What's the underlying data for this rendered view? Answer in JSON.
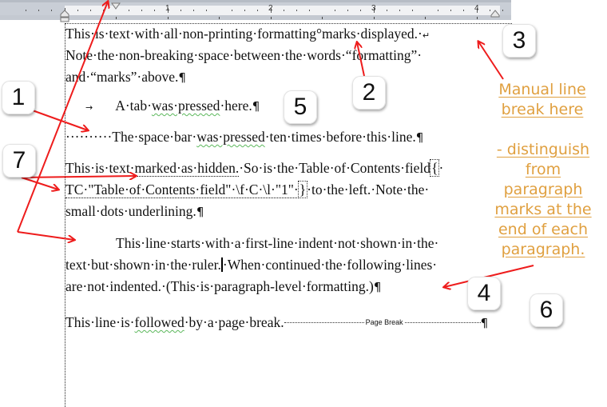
{
  "ruler": {
    "numbers": [
      "1",
      "2",
      "3",
      "4"
    ]
  },
  "document": {
    "p1": {
      "line1": "This·is·text·with·all·non-printing·formatting°marks·displayed.·",
      "line1_break": "↵",
      "line2": "Note·the·non-breaking·space·between·the·words·“formatting”·",
      "line3": "and·“marks”·above.",
      "pilcrow": "¶"
    },
    "p2": {
      "tab_mark": "→",
      "text_a": "A·tab·",
      "text_squig1": "was·pressed",
      "text_b": "·here.",
      "pilcrow": "¶"
    },
    "p3": {
      "dots": "··········",
      "text_a": "The·space·bar·",
      "text_squig": "was·pressed",
      "text_b": "·ten·times·before·this·line.",
      "pilcrow": "¶"
    },
    "p4": {
      "line1_a": "This·is·text·",
      "line1_hidden": "marked·as·hidden.",
      "line1_b": "·So·is·the·Table·of·Contents·field",
      "brace_open": "{",
      "line1_end": "·",
      "line2_hidden": "TC·\"Table·of·Contents·field\"·\\f·C·\\l·\"1\"·",
      "brace_close": "}",
      "line2_b": "·to·the·left.·Note·the·",
      "line3": "small·dots·underlining.",
      "pilcrow": "¶"
    },
    "p5": {
      "line1": "This·line·starts·with·a·first-line·indent·not·shown·in·the·",
      "line2_a": "text·but·shown·in·the·ruler.",
      "line2_b": "·When·continued·the·following·lines·",
      "line3": "are·not·indented.·(This·is·paragraph-level·formatting.)",
      "pilcrow": "¶"
    },
    "p6": {
      "text_a": "This·line·is·",
      "text_squig": "followed",
      "text_b": "·by·a·page·break.",
      "page_break_label": "Page Break",
      "pilcrow": "¶"
    }
  },
  "callouts": [
    "1",
    "2",
    "3",
    "4",
    "5",
    "6",
    "7"
  ],
  "notes": {
    "manual_break": [
      "Manual line",
      "break here"
    ],
    "distinguish": [
      "- distinguish",
      "from",
      "paragraph",
      "marks at the",
      "end of each",
      "paragraph."
    ]
  },
  "colors": {
    "note": "#e0a040",
    "arrow": "#ee1c1c",
    "spellcheck": "#5cb85c"
  }
}
